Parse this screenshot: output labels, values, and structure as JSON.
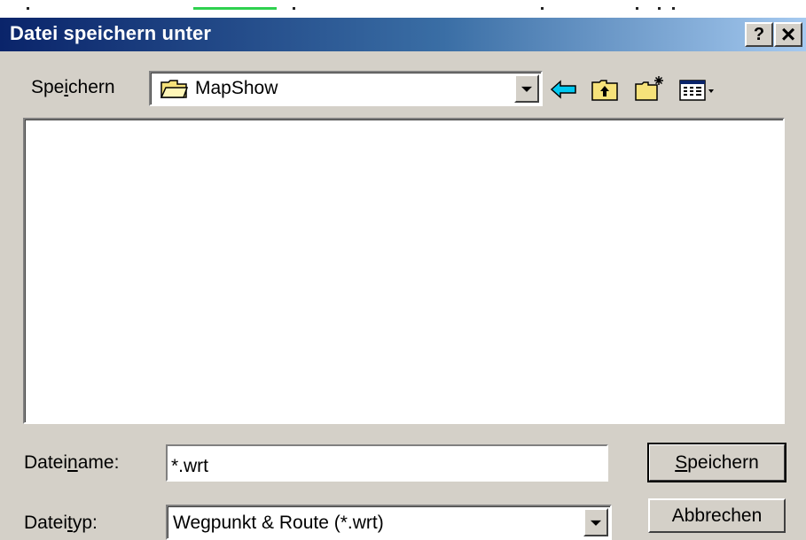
{
  "dialog": {
    "title": "Datei speichern unter",
    "help_label": "?",
    "close_label": "×"
  },
  "location": {
    "label_pre": "Spe",
    "label_accel": "i",
    "label_post": "chern",
    "current_folder": "MapShow"
  },
  "toolbar": {
    "icons": [
      "back-arrow-icon",
      "up-folder-icon",
      "new-folder-icon",
      "view-menu-icon"
    ]
  },
  "filename": {
    "label_pre": "Datei",
    "label_accel": "n",
    "label_post": "ame:",
    "value": "*.wrt"
  },
  "filetype": {
    "label_pre": "Datei",
    "label_accel": "t",
    "label_post": "yp:",
    "selected": "Wegpunkt & Route (*.wrt)"
  },
  "buttons": {
    "save_accel": "S",
    "save_rest": "peichern",
    "cancel": "Abbrechen"
  },
  "colors": {
    "titlebar_start": "#0a246a",
    "titlebar_end": "#a6caf0",
    "face": "#d4d0c8"
  }
}
